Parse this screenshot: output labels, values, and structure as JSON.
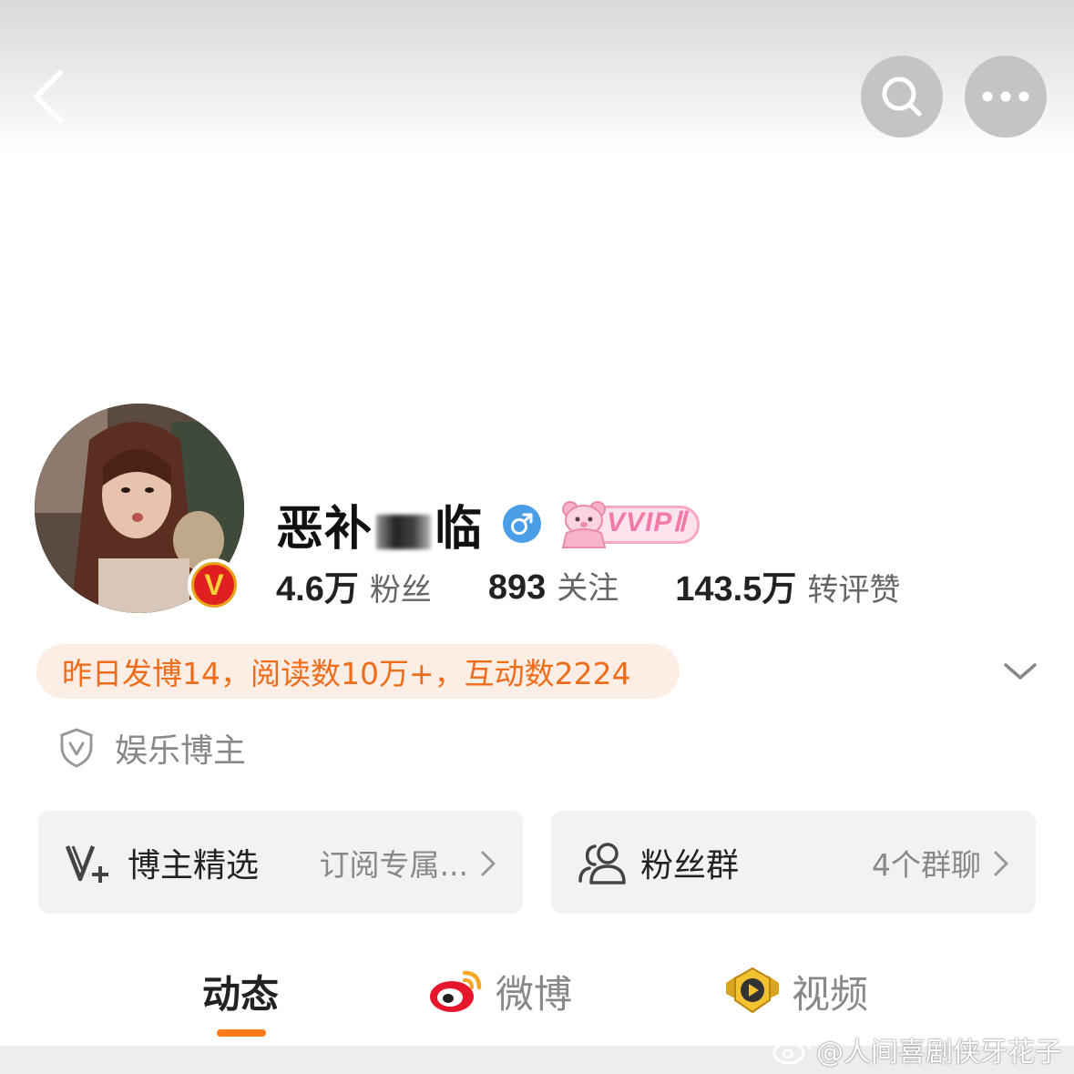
{
  "header": {
    "back_icon": "chevron-left-icon",
    "search_icon": "search-icon",
    "more_icon": "more-horizontal-icon"
  },
  "profile": {
    "name_part1": "恶",
    "name_part2": "补",
    "name_part3": "临",
    "gender": "male",
    "vip_label": "VVIPⅡ",
    "verified_badge": "V"
  },
  "stats": [
    {
      "value": "4.6万",
      "label": "粉丝"
    },
    {
      "value": "893",
      "label": "关注"
    },
    {
      "value": "143.5万",
      "label": "转评赞"
    }
  ],
  "activity": {
    "text": "昨日发博14，阅读数10万+，互动数2224"
  },
  "category": {
    "label": "娱乐博主"
  },
  "cards": {
    "featured": {
      "title": "博主精选",
      "subtitle": "订阅专属..."
    },
    "fan_group": {
      "title": "粉丝群",
      "subtitle": "4个群聊"
    }
  },
  "tabs": [
    {
      "label": "动态",
      "active": true
    },
    {
      "label": "微博",
      "active": false
    },
    {
      "label": "视频",
      "active": false
    }
  ],
  "watermark": {
    "text": "@人间喜剧侠牙花子"
  },
  "colors": {
    "accent_orange": "#ef6d1a",
    "indicator_orange": "#ff7a1a",
    "gender_blue": "#4a9ee8",
    "vip_pink": "#f27aa6",
    "card_bg": "#f2f2f2"
  }
}
